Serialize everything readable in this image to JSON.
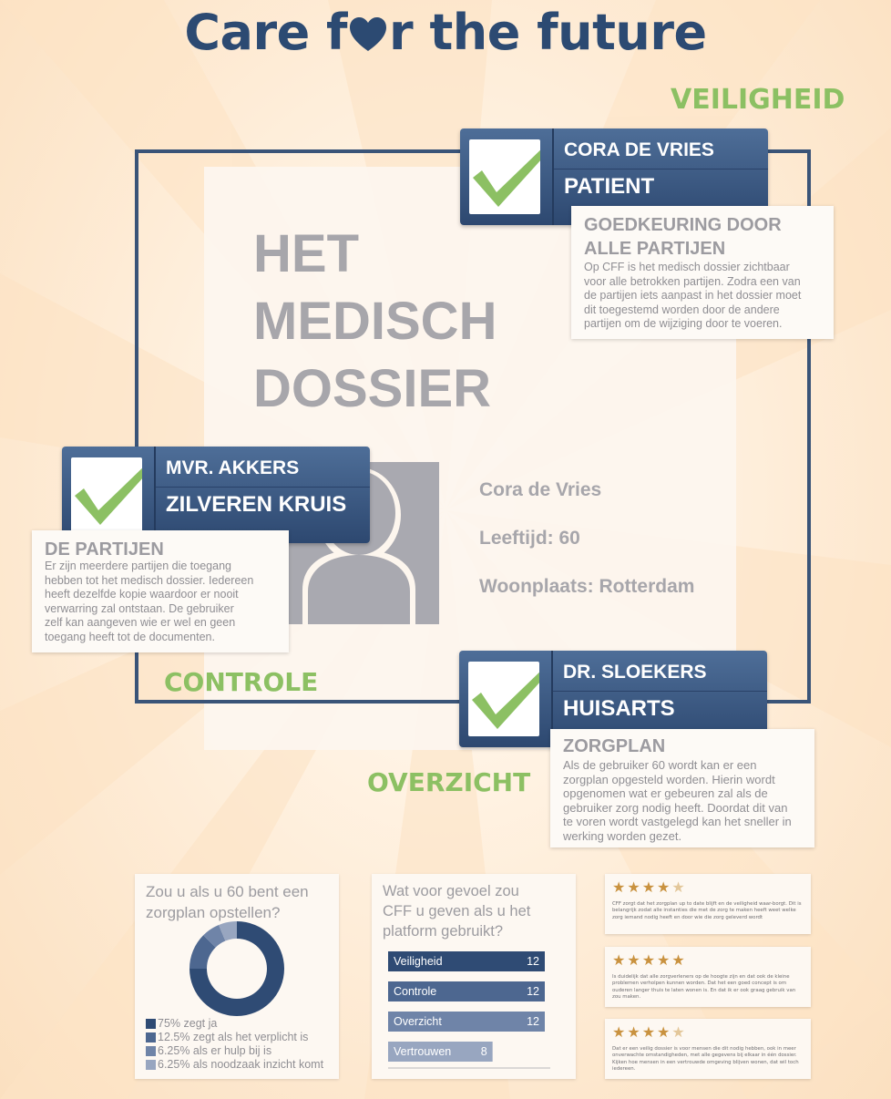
{
  "header": {
    "title_part1": "Care f",
    "title_part2": "r the future"
  },
  "labels": {
    "veiligheid": "VEILIGHEID",
    "controle": "CONTROLE",
    "overzicht": "OVERZICHT"
  },
  "dossier": {
    "title_line1": "HET",
    "title_line2": "MEDISCH",
    "title_line3": "DOSSIER",
    "name": "Cora  de Vries",
    "age": "Leeftijd: 60",
    "city": "Woonplaats: Rotterdam"
  },
  "cards": [
    {
      "name": "CORA DE VRIES",
      "role": "PATIENT"
    },
    {
      "name": "MVR. AKKERS",
      "role": "ZILVEREN KRUIS"
    },
    {
      "name": "DR. SLOEKERS",
      "role": "HUISARTS"
    }
  ],
  "notes": {
    "goedkeuring": {
      "title_line1": "GOEDKEURING DOOR",
      "title_line2": "ALLE PARTIJEN",
      "lines": [
        "Op CFF is het medisch dossier zichtbaar",
        "voor alle betrokken partijen. Zodra een van",
        "de partijen iets aanpast in het dossier moet",
        "dit toegestemd worden door de andere",
        "partijen om de wijziging door te voeren."
      ]
    },
    "partijen": {
      "title": "DE PARTIJEN",
      "lines": [
        "Er zijn meerdere partijen die toegang",
        "hebben tot het medisch dossier. Iedereen",
        "heeft dezelfde kopie waardoor er nooit",
        "verwarring zal ontstaan. De gebruiker",
        "zelf kan aangeven wie er wel en geen",
        "toegang heeft tot de documenten."
      ]
    },
    "zorgplan": {
      "title": "ZORGPLAN",
      "lines": [
        "Als de gebruiker 60 wordt kan er een",
        "zorgplan opgesteld worden. Hierin wordt",
        "opgenomen wat er gebeuren zal als de",
        "gebruiker zorg nodig heeft. Doordat dit van",
        "te voren wordt vastgelegd kan het sneller in",
        "werking worden gezet."
      ]
    }
  },
  "chart_data": [
    {
      "type": "pie",
      "title_line1": "Zou u als u 60 bent een",
      "title_line2": "zorgplan opstellen?",
      "labels": [
        "75% zegt ja",
        "12.5% zegt als het verplicht is",
        "6.25% als er hulp bij is",
        "6.25% als noodzaak inzicht komt"
      ],
      "values": [
        75,
        12.5,
        6.25,
        6.25
      ],
      "colors": [
        "#2f4b74",
        "#4d6790",
        "#6f84a8",
        "#98a6c0"
      ]
    },
    {
      "type": "bar",
      "title_line1": "Wat voor gevoel zou",
      "title_line2": "CFF u geven als u  het",
      "title_line3": "platform gebruikt?",
      "categories": [
        "Veiligheid",
        "Controle",
        "Overzicht",
        "Vertrouwen"
      ],
      "values": [
        12,
        12,
        12,
        8
      ],
      "value_labels": [
        "12",
        "12",
        "12",
        "8"
      ],
      "colors": [
        "#2f4b74",
        "#4d6790",
        "#6f84a8",
        "#98a6c0"
      ],
      "xlim": [
        0,
        12
      ]
    }
  ],
  "reviews": [
    {
      "stars": 4,
      "text": "CFF zorgt dat het zorgplan up to date blijft en de veiligheid waar-borgt. Dit is belangrijk zodat alle instanties die met de zorg te maken heeft weet welke zorg iemand nodig heeft en door wie die zorg geleverd wordt"
    },
    {
      "stars": 5,
      "text": "Is duidelijk dat alle zorgverleners op de hoogte zijn en dat ook de kleine problemen verholpen kunnen worden. Dat het een goed concept is om ouderen langer thuis te laten wonen is. En dat ik er ook graag gebruik van zou maken."
    },
    {
      "stars": 4,
      "text": "Dat er een veilig dossier is voor mensen die dit nodig hebben, ook in meer onverwachte omstandigheden, met alle gegevens bij elkaar in één dossier. Kijken hoe mensen in een vertrouwde omgeving blijven wonen, dat wil toch iedereen."
    }
  ]
}
